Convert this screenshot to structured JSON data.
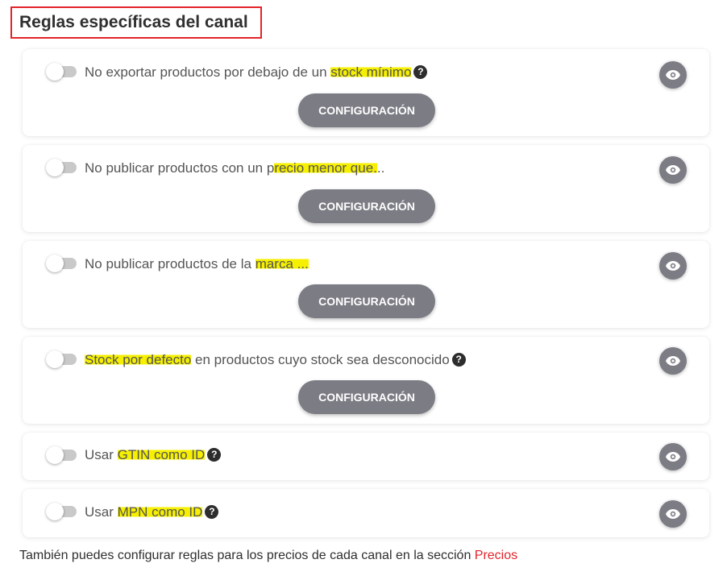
{
  "section": {
    "title": "Reglas específicas del canal"
  },
  "rules": [
    {
      "pre": "No exportar productos por debajo de un ",
      "hl": "stock mínimo",
      "post": "",
      "help": "?",
      "button": "CONFIGURACIÓN",
      "enabled": false
    },
    {
      "pre": "No publicar productos con un p",
      "hl": "recio menor que.",
      "post": "..",
      "button": "CONFIGURACIÓN",
      "enabled": false
    },
    {
      "pre": "No publicar productos de la ",
      "hl": "marca ...",
      "post": "",
      "button": "CONFIGURACIÓN",
      "enabled": false
    },
    {
      "pre": "",
      "hl": "Stock por defecto",
      "post": " en productos cuyo stock sea desconocido",
      "help": "?",
      "button": "CONFIGURACIÓN",
      "enabled": false
    },
    {
      "pre": "Usar ",
      "hl": "GTIN como ID",
      "post": "",
      "help": "?",
      "enabled": false
    },
    {
      "pre": "Usar ",
      "hl": "MPN como ID",
      "post": "",
      "help": "?",
      "enabled": false
    }
  ],
  "footer": {
    "text": "También puedes configurar reglas para los precios de cada canal en la sección ",
    "link": "Precios"
  },
  "colors": {
    "accent": "#e3242b",
    "button": "#7b7c84",
    "highlight": "#f6f000"
  },
  "icons": {
    "eye": "eye-icon",
    "help": "question-circle-icon"
  }
}
